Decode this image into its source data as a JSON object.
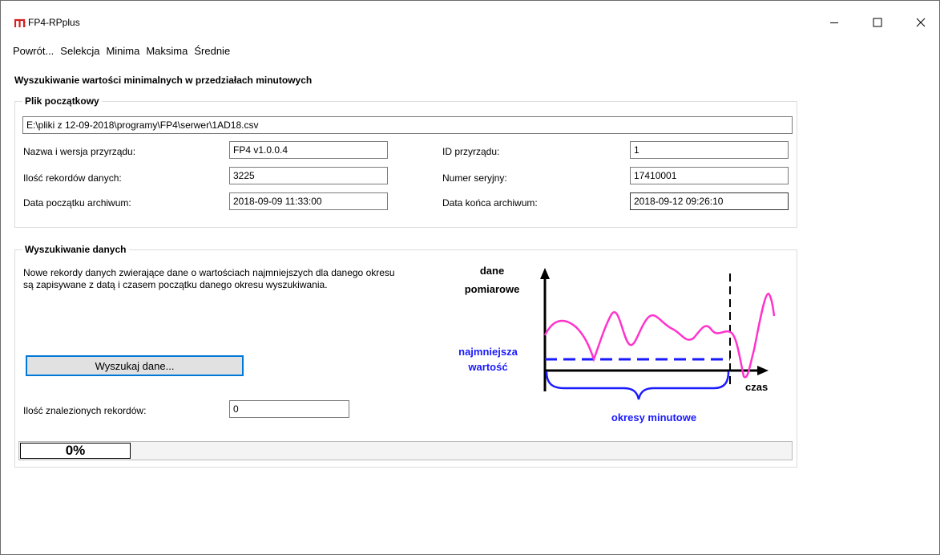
{
  "window": {
    "title": "FP4-RPplus",
    "minimize_glyph": "—",
    "maximize_glyph": "☐",
    "close_glyph": "✕"
  },
  "menu": [
    "Powrót...",
    "Selekcja",
    "Minima",
    "Maksima",
    "Średnie"
  ],
  "page_title": "Wyszukiwanie wartości minimalnych w przedziałach minutowych",
  "file_group": {
    "label": "Plik początkowy",
    "path": "E:\\pliki z 12-09-2018\\programy\\FP4\\serwer\\1AD18.csv",
    "device_name_label": "Nazwa i wersja przyrządu:",
    "device_name": "FP4 v1.0.0.4",
    "device_id_label": "ID przyrządu:",
    "device_id": "1",
    "records_label": "Ilość rekordów danych:",
    "records": "3225",
    "serial_label": "Numer seryjny:",
    "serial": "17410001",
    "start_label": "Data początku archiwum:",
    "start": "2018-09-09 11:33:00",
    "end_label": "Data końca archiwum:",
    "end": "2018-09-12 09:26:10"
  },
  "search_group": {
    "label": "Wyszukiwanie danych",
    "description": "Nowe rekordy danych zwierające dane o wartościach najmniejszych dla danego okresu są zapisywane z datą i czasem początku danego okresu wyszukiwania.",
    "button": "Wyszukaj dane...",
    "found_label": "Ilość znalezionych rekordów:",
    "found": "0"
  },
  "diagram": {
    "y_label_1": "dane",
    "y_label_2": "pomiarowe",
    "min_label_1": "najmniejsza",
    "min_label_2": "wartość",
    "x_label": "czas",
    "period_label": "okresy minutowe",
    "signal_color": "#ff33cc",
    "min_color": "#1a1aff"
  },
  "progress": {
    "value": "0%"
  }
}
